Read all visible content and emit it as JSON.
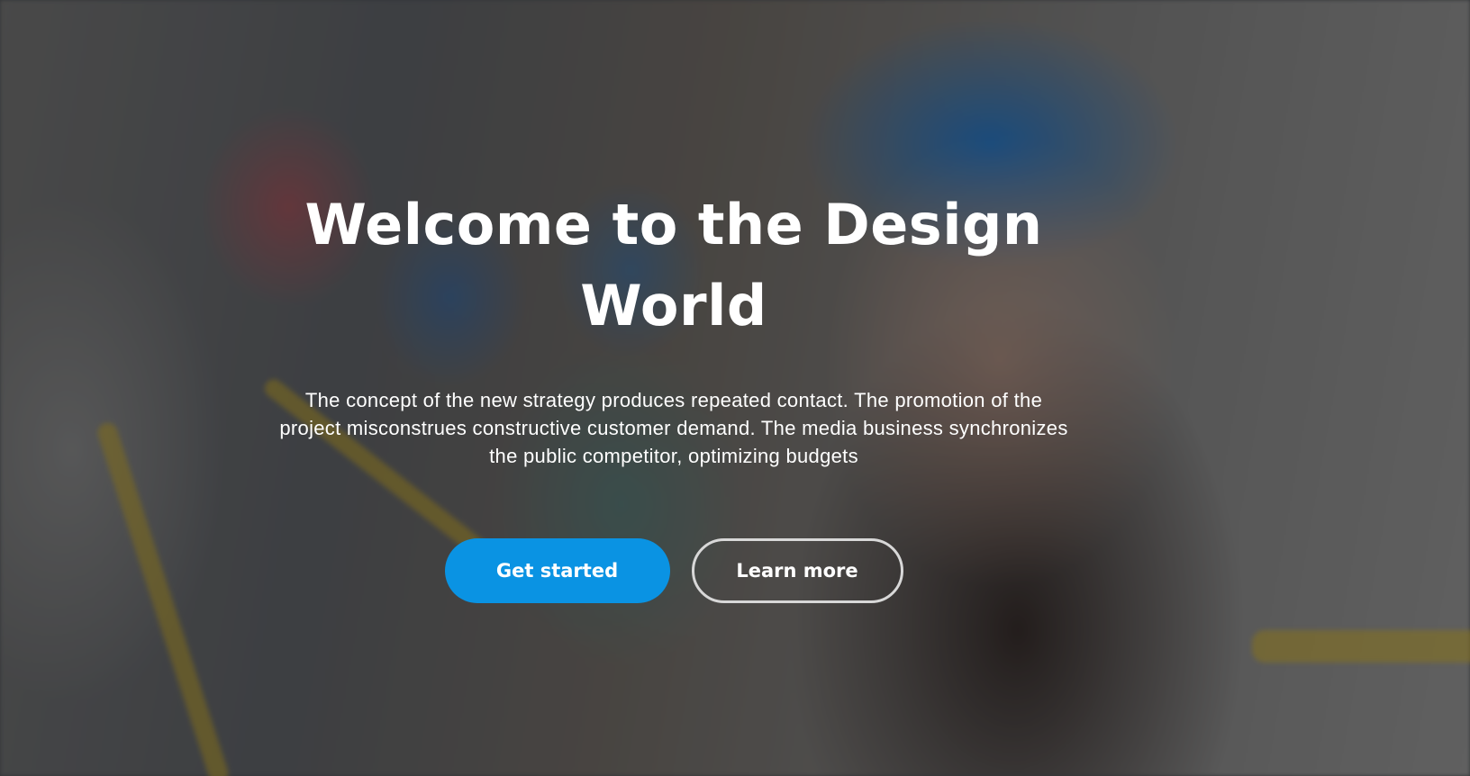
{
  "hero": {
    "title": "Welcome to the Design World",
    "description": "The concept of the new strategy produces repeated contact. The promotion of the project misconstrues constructive customer demand. The media business synchronizes the public competitor, optimizing budgets",
    "primary_button_label": "Get started",
    "secondary_button_label": "Learn more"
  },
  "colors": {
    "primary_button": "#0a93e3",
    "outline_button_border": "#d8d8d8",
    "text": "#ffffff"
  }
}
